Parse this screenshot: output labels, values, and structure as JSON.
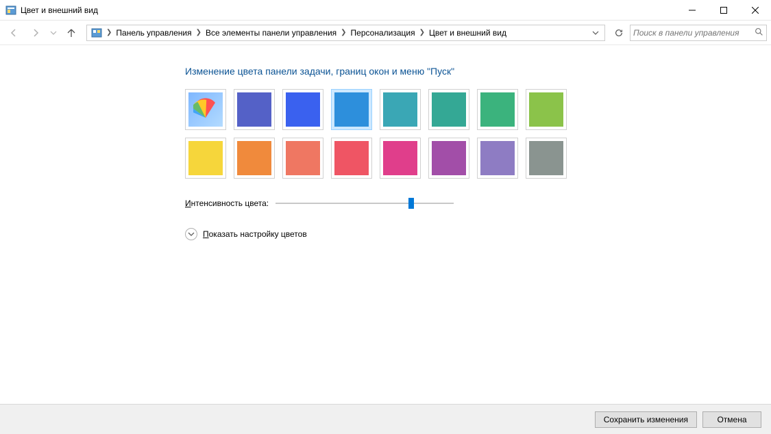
{
  "window": {
    "title": "Цвет и внешний вид"
  },
  "breadcrumb": {
    "items": [
      "Панель управления",
      "Все элементы панели управления",
      "Персонализация",
      "Цвет и внешний вид"
    ]
  },
  "search": {
    "placeholder": "Поиск в панели управления"
  },
  "heading": "Изменение цвета панели задачи, границ окон и меню \"Пуск\"",
  "swatches": [
    {
      "name": "auto",
      "color": "auto",
      "selected": false
    },
    {
      "name": "indigo",
      "color": "#5461c7",
      "selected": false
    },
    {
      "name": "royal-blue",
      "color": "#3a61ef",
      "selected": false
    },
    {
      "name": "azure",
      "color": "#2d8fdc",
      "selected": true
    },
    {
      "name": "teal",
      "color": "#3aa7b5",
      "selected": false
    },
    {
      "name": "sea-green",
      "color": "#34a895",
      "selected": false
    },
    {
      "name": "emerald",
      "color": "#3bb37d",
      "selected": false
    },
    {
      "name": "lime",
      "color": "#8bc34a",
      "selected": false
    },
    {
      "name": "yellow",
      "color": "#f6d63b",
      "selected": false
    },
    {
      "name": "orange",
      "color": "#f08a3c",
      "selected": false
    },
    {
      "name": "light-coral",
      "color": "#ef7762",
      "selected": false
    },
    {
      "name": "coral",
      "color": "#ef5564",
      "selected": false
    },
    {
      "name": "magenta",
      "color": "#e03e8b",
      "selected": false
    },
    {
      "name": "violet",
      "color": "#a24ea8",
      "selected": false
    },
    {
      "name": "lavender",
      "color": "#8e7cc3",
      "selected": false
    },
    {
      "name": "gray",
      "color": "#8a9490",
      "selected": false
    }
  ],
  "intensity": {
    "label_u": "И",
    "label_rest": "нтенсивность цвета:",
    "value": 0.77
  },
  "expand": {
    "label_u": "П",
    "label_rest": "оказать настройку цветов"
  },
  "footer": {
    "save": "Сохранить изменения",
    "cancel": "Отмена"
  }
}
